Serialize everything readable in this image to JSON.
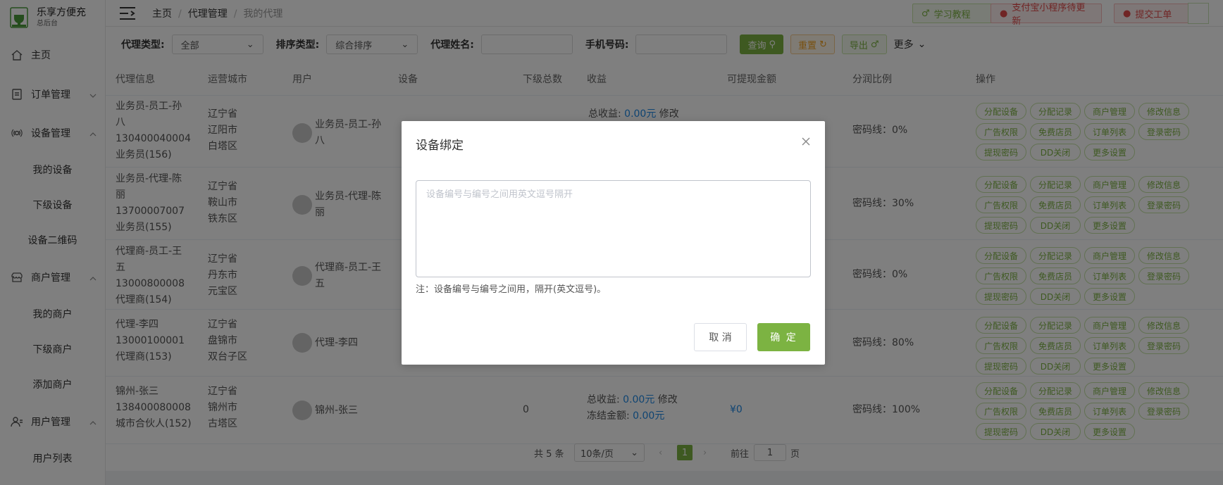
{
  "app": {
    "title": "乐享方便充",
    "subtitle": "总后台"
  },
  "sidebar": {
    "items": [
      {
        "label": "主页",
        "icon": "home-icon"
      },
      {
        "label": "订单管理",
        "icon": "order-icon"
      },
      {
        "label": "设备管理",
        "icon": "device-icon"
      },
      {
        "label": "我的设备"
      },
      {
        "label": "下级设备"
      },
      {
        "label": "设备二维码"
      },
      {
        "label": "商户管理",
        "icon": "shop-icon"
      },
      {
        "label": "我的商户"
      },
      {
        "label": "下级商户"
      },
      {
        "label": "添加商户"
      },
      {
        "label": "用户管理",
        "icon": "user-icon"
      },
      {
        "label": "用户列表"
      }
    ]
  },
  "breadcrumb": [
    "主页",
    "代理管理",
    "我的代理"
  ],
  "top_buttons": {
    "tutorial": "学习教程",
    "alipay": "支付宝小程序待更新",
    "ticket": "提交工单"
  },
  "filter": {
    "agent_type_label": "代理类型:",
    "agent_type_value": "全部",
    "sort_label": "排序类型:",
    "sort_value": "综合排序",
    "name_label": "代理姓名:",
    "phone_label": "手机号码:",
    "query": "查询",
    "reset": "重置",
    "export": "导出",
    "more": "更多"
  },
  "table": {
    "headers": [
      "代理信息",
      "运营城市",
      "用户",
      "设备",
      "下级总数",
      "收益",
      "可提现金额",
      "分润比例",
      "操作"
    ],
    "rows": [
      {
        "info": [
          "业务员-员工-孙",
          "八",
          "130400040004",
          "业务员(156)"
        ],
        "city": [
          "辽宁省",
          "辽阳市",
          "白塔区"
        ],
        "user": [
          "业务员-员工-孙",
          "八"
        ],
        "ratio": "密码线：0%"
      },
      {
        "info": [
          "业务员-代理-陈",
          "丽",
          "13700007007",
          "业务员(155)"
        ],
        "city": [
          "辽宁省",
          "鞍山市",
          "铁东区"
        ],
        "user": [
          "业务员-代理-陈",
          "丽"
        ],
        "ratio": "密码线：30%"
      },
      {
        "info": [
          "代理商-员工-王",
          "五",
          "13000800008",
          "代理商(154)"
        ],
        "city": [
          "辽宁省",
          "丹东市",
          "元宝区"
        ],
        "user": [
          "代理商-员工-王",
          "五"
        ],
        "ratio": "密码线：0%"
      },
      {
        "info": [
          "代理-李四",
          "13000100001",
          "代理商(153)"
        ],
        "city": [
          "辽宁省",
          "盘锦市",
          "双台子区"
        ],
        "user": [
          "代理-李四"
        ],
        "ratio": "密码线：80%"
      },
      {
        "info": [
          "锦州-张三",
          "138400080008",
          "城市合伙人(152)"
        ],
        "city": [
          "辽宁省",
          "锦州市",
          "古塔区"
        ],
        "user": [
          "锦州-张三"
        ],
        "sub": "0",
        "income_label": "总收益:",
        "income_val": "0.00元",
        "modify": "修改",
        "frozen_label": "冻结金额:",
        "frozen_val": "0.00元",
        "withdraw": "¥0",
        "ratio": "密码线：100%"
      }
    ],
    "partial_row1": {
      "text": "总收益:",
      "val": "0.00元",
      "modify": "修改"
    },
    "ops": [
      "分配设备",
      "分配记录",
      "商户管理",
      "修改信息",
      "广告权限",
      "免费店员",
      "订单列表",
      "登录密码",
      "提现密码",
      "DD关闭",
      "更多设置"
    ]
  },
  "pager": {
    "total": "共 5 条",
    "size": "10条/页",
    "page": "1",
    "goto": "前往",
    "goto_value": "1",
    "page_unit": "页"
  },
  "modal": {
    "title": "设备绑定",
    "placeholder": "设备编号与编号之间用英文逗号隔开",
    "note": "注：设备编号与编号之间用，隔开(英文逗号)。",
    "cancel": "取 消",
    "ok": "确 定"
  },
  "colors": {
    "accent": "#7cb342",
    "danger": "#e04b4b",
    "warning": "#f0a020",
    "link": "#1e88e5"
  }
}
